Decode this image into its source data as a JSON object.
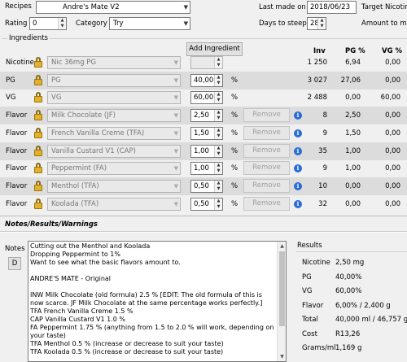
{
  "top": {
    "recipes_label": "Recipes",
    "recipe_name": "Andre's Mate V2",
    "rating_label": "Rating",
    "rating_value": "0",
    "category_label": "Category",
    "category_value": "Try",
    "last_made_label": "Last made on",
    "last_made_value": "2018/06/23",
    "target_nicotine_label": "Target Nicotine",
    "days_to_steep_label": "Days to steep",
    "days_to_steep_value": "28",
    "amount_to_make_label": "Amount to make"
  },
  "ingredients": {
    "group_label": "Ingredients",
    "add_button": "Add Ingredient",
    "col_inv": "Inv",
    "col_pg": "PG %",
    "col_vg": "VG %",
    "rows": [
      {
        "type": "Nicotine",
        "name": "Nic 36mg PG",
        "pct": "",
        "unit": "",
        "remove": "",
        "inv": "1 250",
        "pg": "6,94",
        "vg": "0,00"
      },
      {
        "type": "PG",
        "name": "PG",
        "pct": "40,00",
        "unit": "%",
        "remove": "",
        "inv": "3 027",
        "pg": "27,06",
        "vg": "0,00"
      },
      {
        "type": "VG",
        "name": "VG",
        "pct": "60,00",
        "unit": "%",
        "remove": "",
        "inv": "2 488",
        "pg": "0,00",
        "vg": "60,00"
      },
      {
        "type": "Flavor",
        "name": "Milk Chocolate (JF)",
        "pct": "2,50",
        "unit": "%",
        "remove": "Remove",
        "inv": "8",
        "pg": "2,50",
        "vg": "0,00"
      },
      {
        "type": "Flavor",
        "name": "French Vanilla Creme (TFA)",
        "pct": "1,50",
        "unit": "%",
        "remove": "Remove",
        "inv": "9",
        "pg": "1,50",
        "vg": "0,00"
      },
      {
        "type": "Flavor",
        "name": "Vanilla Custard V1 (CAP)",
        "pct": "1,00",
        "unit": "%",
        "remove": "Remove",
        "inv": "35",
        "pg": "1,00",
        "vg": "0,00"
      },
      {
        "type": "Flavor",
        "name": "Peppermint (FA)",
        "pct": "1,00",
        "unit": "%",
        "remove": "Remove",
        "inv": "9",
        "pg": "1,00",
        "vg": "0,00"
      },
      {
        "type": "Flavor",
        "name": "Menthol (TFA)",
        "pct": "0,50",
        "unit": "%",
        "remove": "Remove",
        "inv": "10",
        "pg": "0,00",
        "vg": "0,00"
      },
      {
        "type": "Flavor",
        "name": "Koolada (TFA)",
        "pct": "0,50",
        "unit": "%",
        "remove": "Remove",
        "inv": "32",
        "pg": "0,00",
        "vg": "0,00"
      }
    ]
  },
  "notes_panel": {
    "header": "Notes/Results/Warnings",
    "notes_label": "Notes",
    "d_button": "D",
    "notes_lines": [
      "Cutting out the Menthol and Koolada",
      "Dropping Peppermint to 1%",
      "Want to see what the basic flavors amount to.",
      "",
      "ANDRE'S MATE - Original",
      "",
      "INW Milk Chocolate (old formula) 2.5 % [EDIT: The old formula of this is now scarce. JF Milk Chocolate at the same percentage works perfectly.]",
      "TFA French Vanilla Creme 1.5 %",
      "CAP Vanilla Custard V1 1.0 %",
      "FA Peppermint 1.75 % (anything from 1.5 to 2.0 % will work, depending on your taste)",
      "TFA Menthol 0.5 % (increase or decrease to suit your taste)",
      "TFA Koolada 0.5 % (increase or decrease to suit your taste)"
    ]
  },
  "results": {
    "title": "Results",
    "items": [
      {
        "label": "Nicotine",
        "value": "2,50 mg"
      },
      {
        "label": "PG",
        "value": "40,00%"
      },
      {
        "label": "VG",
        "value": "60,00%"
      },
      {
        "label": "Flavor",
        "value": "6,00% / 2,400 g"
      },
      {
        "label": "Total",
        "value": "40,000 ml / 46,757 g"
      },
      {
        "label": "Cost",
        "value": "R13,26"
      },
      {
        "label": "Grams/ml",
        "value": "1,169 g"
      }
    ]
  }
}
